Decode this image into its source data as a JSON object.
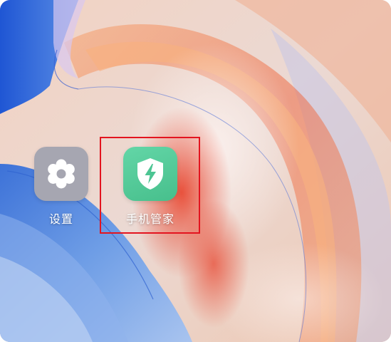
{
  "apps": [
    {
      "label": "设置",
      "icon": "gear-icon",
      "color": "#a6a6b1"
    },
    {
      "label": "手机管家",
      "icon": "shield-bolt-icon",
      "color": "#56c99a"
    }
  ],
  "highlight": {
    "color": "#e3141f"
  }
}
